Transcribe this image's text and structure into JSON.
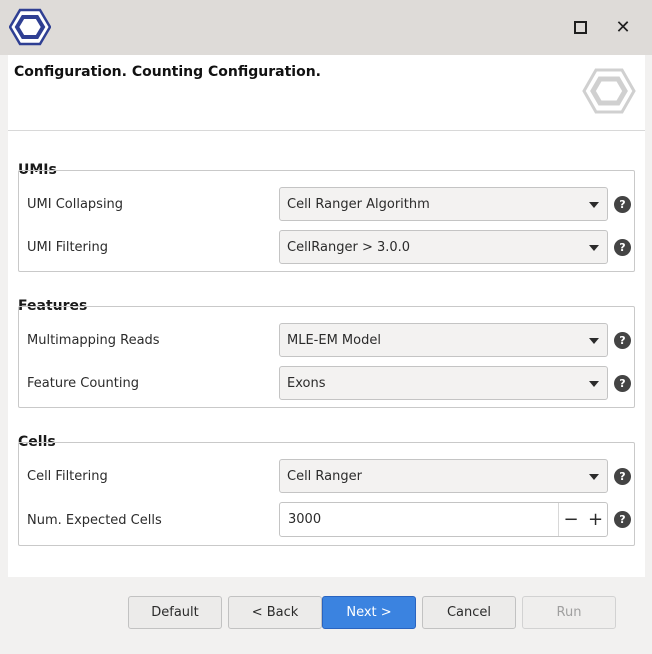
{
  "window": {
    "maximize_icon": "maximize-icon",
    "close_icon": "close-icon",
    "close_glyph": "✕"
  },
  "header": {
    "title": "Configuration. Counting Configuration."
  },
  "groups": {
    "umis": {
      "title": "UMIs",
      "rows": [
        {
          "label": "UMI Collapsing",
          "value": "Cell Ranger Algorithm"
        },
        {
          "label": "UMI Filtering",
          "value": "CellRanger > 3.0.0"
        }
      ]
    },
    "features": {
      "title": "Features",
      "rows": [
        {
          "label": "Multimapping Reads",
          "value": "MLE-EM Model"
        },
        {
          "label": "Feature Counting",
          "value": "Exons"
        }
      ]
    },
    "cells": {
      "title": "Cells",
      "rows": [
        {
          "label": "Cell Filtering",
          "value": "Cell Ranger"
        },
        {
          "label": "Num. Expected Cells",
          "value": "3000"
        }
      ]
    }
  },
  "help_glyph": "?",
  "spin": {
    "minus": "−",
    "plus": "+"
  },
  "buttons": {
    "default": "Default",
    "back": "< Back",
    "next": "Next >",
    "cancel": "Cancel",
    "run": "Run"
  },
  "colors": {
    "primary": "#3b83e0",
    "titlebar": "#dedbd8",
    "logo": "#2f3f93"
  }
}
